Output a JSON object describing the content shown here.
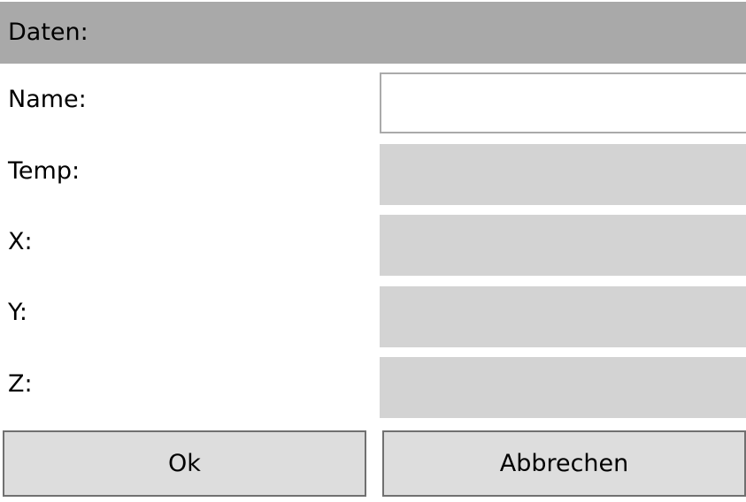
{
  "header": {
    "title": "Daten:"
  },
  "form": {
    "fields": [
      {
        "label": "Name:",
        "value": ""
      },
      {
        "label": "Temp:",
        "value": ""
      },
      {
        "label": "X:",
        "value": ""
      },
      {
        "label": "Y:",
        "value": ""
      },
      {
        "label": "Z:",
        "value": ""
      }
    ]
  },
  "buttons": {
    "ok_label": "Ok",
    "cancel_label": "Abbrechen"
  },
  "colors": {
    "header_bg": "#a9a9a9",
    "readonly_field_bg": "#d3d3d3",
    "button_bg": "#dddddd",
    "button_border": "#707070"
  }
}
